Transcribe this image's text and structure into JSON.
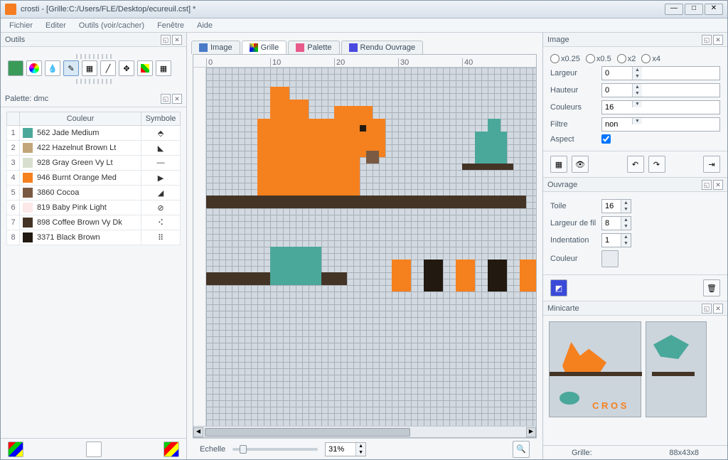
{
  "window": {
    "title": "crosti - [Grille:C:/Users/FLE/Desktop/ecureuil.cst] *"
  },
  "menu": {
    "file": "Fichier",
    "edit": "Editer",
    "tools": "Outils (voir/cacher)",
    "window": "Fenêtre",
    "help": "Aide"
  },
  "panels": {
    "outils": "Outils",
    "palette": "Palette: dmc",
    "image": "Image",
    "ouvrage": "Ouvrage",
    "minicarte": "Minicarte"
  },
  "palette": {
    "headers": {
      "couleur": "Couleur",
      "symbole": "Symbole"
    },
    "rows": [
      {
        "n": "1",
        "hex": "#4aa89a",
        "name": "562 Jade Medium",
        "sym": "⬘"
      },
      {
        "n": "2",
        "hex": "#c2a679",
        "name": "422 Hazelnut Brown Lt",
        "sym": "◣"
      },
      {
        "n": "3",
        "hex": "#d8dfce",
        "name": "928 Gray Green Vy Lt",
        "sym": "—"
      },
      {
        "n": "4",
        "hex": "#f5801e",
        "name": "946 Burnt Orange Med",
        "sym": "▶"
      },
      {
        "n": "5",
        "hex": "#7a5a42",
        "name": "3860 Cocoa",
        "sym": "◢"
      },
      {
        "n": "6",
        "hex": "#fce8e8",
        "name": "819 Baby Pink Light",
        "sym": "⊘"
      },
      {
        "n": "7",
        "hex": "#443426",
        "name": "898 Coffee Brown Vy Dk",
        "sym": "⠪"
      },
      {
        "n": "8",
        "hex": "#221a10",
        "name": "3371 Black Brown",
        "sym": "⠿"
      }
    ]
  },
  "tabs": {
    "image": "Image",
    "grille": "Grille",
    "palette": "Palette",
    "rendu": "Rendu Ouvrage"
  },
  "ruler": {
    "marks": [
      "0",
      "10",
      "20",
      "30",
      "40"
    ]
  },
  "zoom": {
    "label": "Echelle",
    "value": "31%"
  },
  "imagePanel": {
    "zoom": {
      "x025": "x0.25",
      "x05": "x0.5",
      "x2": "x2",
      "x4": "x4"
    },
    "largeur": "Largeur",
    "hauteur": "Hauteur",
    "couleurs": "Couleurs",
    "filtre": "Filtre",
    "aspect": "Aspect",
    "largeur_v": "0",
    "hauteur_v": "0",
    "couleurs_v": "16",
    "filtre_v": "non"
  },
  "ouvragePanel": {
    "toile": "Toile",
    "largeur": "Largeur de fil",
    "indent": "Indentation",
    "couleur": "Couleur",
    "toile_v": "16",
    "largeur_v": "8",
    "indent_v": "1"
  },
  "status": {
    "grille": "Grille:",
    "dims": "88x43x8"
  }
}
